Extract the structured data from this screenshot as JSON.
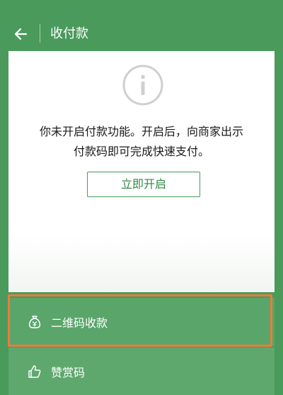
{
  "header": {
    "title": "收付款"
  },
  "notice": {
    "line1": "你未开启付款功能。开启后，向商家出示",
    "line2": "付款码即可完成快速支付。",
    "button": "立即开启"
  },
  "menu": {
    "items": [
      {
        "label": "二维码收款",
        "icon": "money-bag-icon"
      },
      {
        "label": "赞赏码",
        "icon": "thumbs-up-icon"
      }
    ]
  },
  "colors": {
    "primary_green": "#4a9a5c",
    "menu_green": "#5aa56a",
    "highlight_orange": "#ef7a3b",
    "button_text_green": "#2f8a45"
  }
}
